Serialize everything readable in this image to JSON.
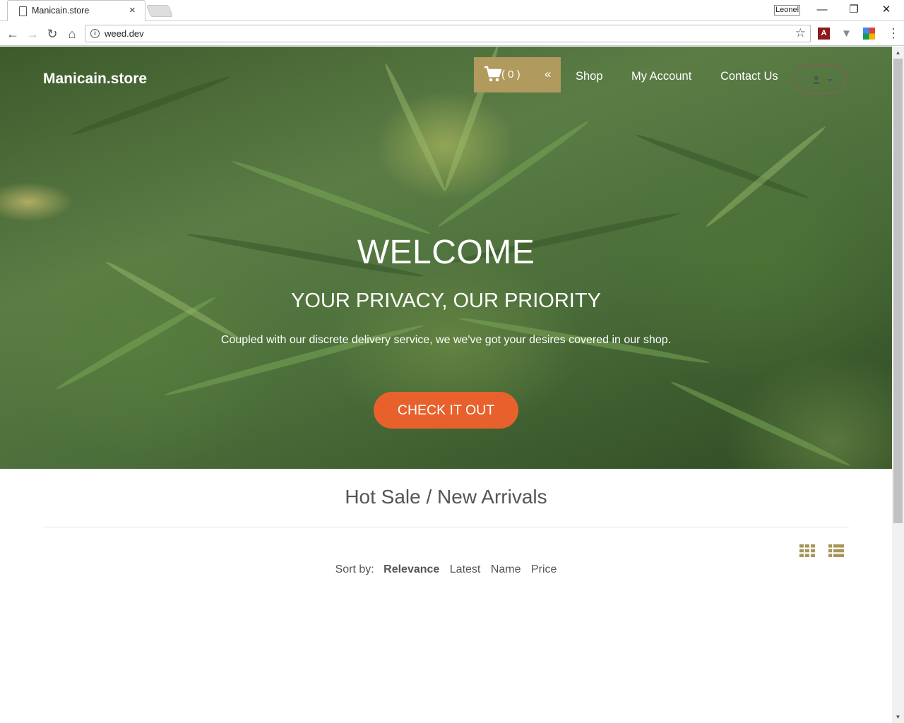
{
  "browser": {
    "tab_title": "Manicain.store",
    "tab_close": "×",
    "profile_name": "Leonel",
    "window": {
      "minimize": "—",
      "restore": "❐",
      "close": "✕"
    },
    "nav": {
      "back": "←",
      "forward": "→",
      "reload": "↻",
      "home": "⌂"
    },
    "url": "weed.dev",
    "info": "i",
    "bookmark": "☆",
    "extensions": {
      "pdf": "A",
      "v": "▼"
    },
    "menu": "⋮"
  },
  "site": {
    "brand": "Manicain.store",
    "cart": {
      "count_label": "( 0 )",
      "toggle": "«"
    },
    "nav": [
      {
        "label": "Shop"
      },
      {
        "label": "My Account"
      },
      {
        "label": "Contact Us"
      }
    ],
    "hero": {
      "title": "WELCOME",
      "subtitle": "YOUR PRIVACY, OUR PRIORITY",
      "text": "Coupled with our discrete delivery service, we we've got your desires covered in our shop.",
      "cta": "CHECK IT OUT"
    },
    "products": {
      "title": "Hot Sale / New Arrivals",
      "sort_label": "Sort by:",
      "sort_options": [
        "Relevance",
        "Latest",
        "Name",
        "Price"
      ],
      "active_sort": "Relevance"
    }
  },
  "colors": {
    "accent_gold": "#b09a5e",
    "cta_orange": "#e8612c",
    "view_icon_gold": "#a8955a"
  }
}
